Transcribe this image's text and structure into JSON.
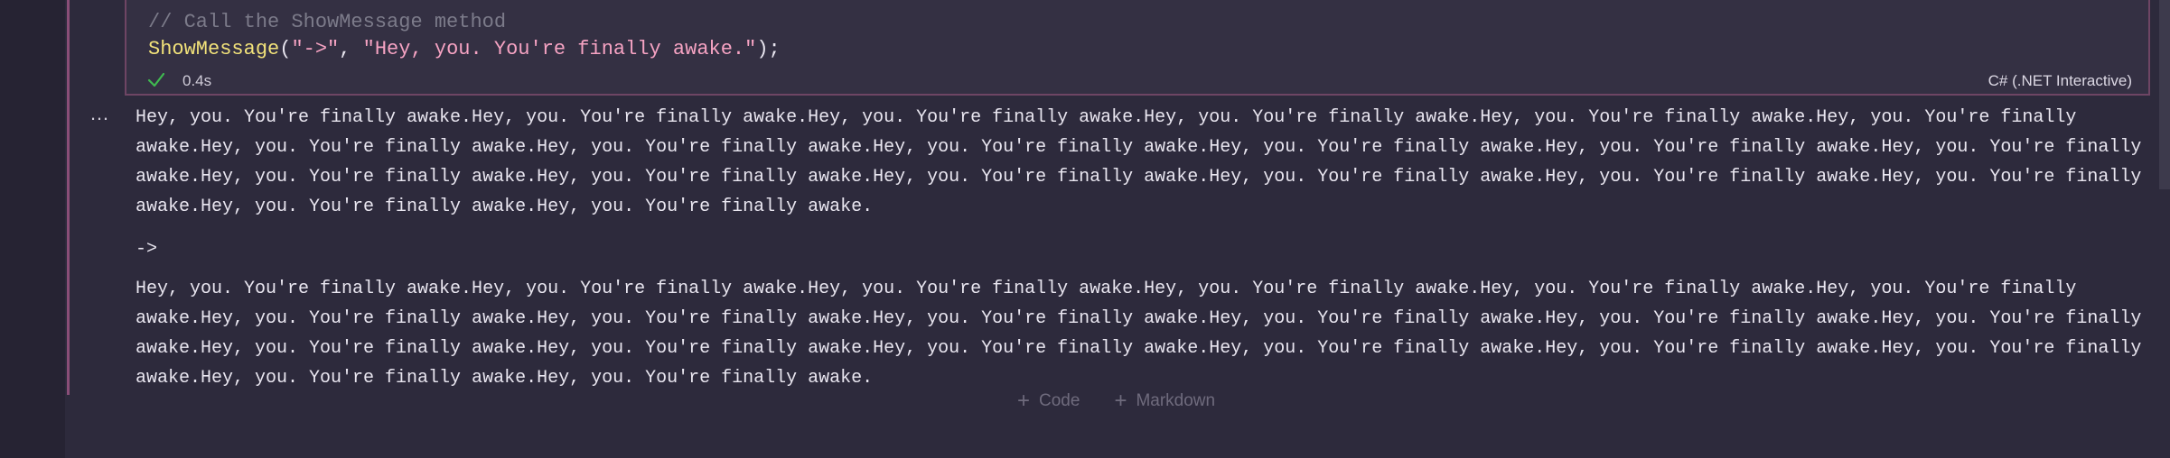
{
  "cell": {
    "code": {
      "comment": "// Call the ShowMessage method",
      "line2": {
        "fn": "ShowMessage",
        "open": "(",
        "arg1": "\"->\"",
        "sep": ", ",
        "arg2": "\"Hey, you. You're finally awake.\"",
        "close": ");"
      }
    },
    "status": {
      "icon": "check-icon",
      "time": "0.4s",
      "color": "#3fb950"
    },
    "kernel": "C# (.NET Interactive)"
  },
  "output": {
    "menu_icon": "ellipsis-icon",
    "menu_glyph": "…",
    "block1": "Hey, you. You're finally awake.Hey, you. You're finally awake.Hey, you. You're finally awake.Hey, you. You're finally awake.Hey, you. You're finally awake.Hey, you. You're finally awake.Hey, you. You're finally awake.Hey, you. You're finally awake.Hey, you. You're finally awake.Hey, you. You're finally awake.Hey, you. You're finally awake.Hey, you. You're finally awake.Hey, you. You're finally awake.Hey, you. You're finally awake.Hey, you. You're finally awake.Hey, you. You're finally awake.Hey, you. You're finally awake.Hey, you. You're finally awake.Hey, you. You're finally awake.Hey, you. You're finally awake.",
    "arrow": "->",
    "block2": "Hey, you. You're finally awake.Hey, you. You're finally awake.Hey, you. You're finally awake.Hey, you. You're finally awake.Hey, you. You're finally awake.Hey, you. You're finally awake.Hey, you. You're finally awake.Hey, you. You're finally awake.Hey, you. You're finally awake.Hey, you. You're finally awake.Hey, you. You're finally awake.Hey, you. You're finally awake.Hey, you. You're finally awake.Hey, you. You're finally awake.Hey, you. You're finally awake.Hey, you. You're finally awake.Hey, you. You're finally awake.Hey, you. You're finally awake.Hey, you. You're finally awake.Hey, you. You're finally awake."
  },
  "add_cell": {
    "code_label": "Code",
    "markdown_label": "Markdown",
    "plus_glyph": "+"
  },
  "colors": {
    "cell_border": "#8a4e78",
    "background": "#2d2a3c"
  }
}
